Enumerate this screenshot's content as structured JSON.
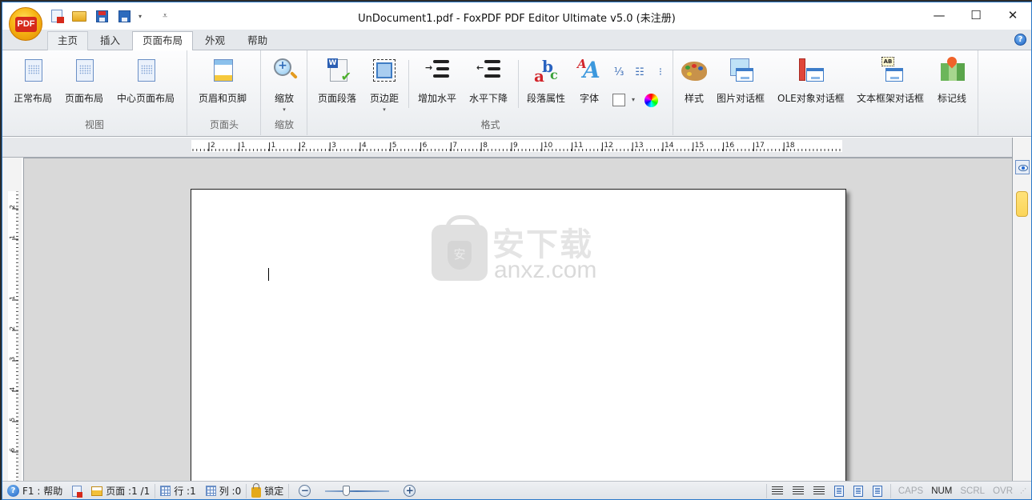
{
  "window": {
    "title": "UnDocument1.pdf - FoxPDF PDF Editor Ultimate v5.0 (未注册)",
    "logo_text": "PDF",
    "controls": {
      "minimize": "—",
      "maximize": "☐",
      "close": "✕"
    }
  },
  "quick_access": [
    {
      "name": "new-pdf",
      "icon": "new-pdf-icon"
    },
    {
      "name": "open",
      "icon": "folder-open-icon"
    },
    {
      "name": "save",
      "icon": "save-icon"
    },
    {
      "name": "save-as",
      "icon": "save-as-icon",
      "dropdown": "▾"
    },
    {
      "name": "customize",
      "glyph": "⩡"
    }
  ],
  "tabs": [
    {
      "label": "主页",
      "active": false
    },
    {
      "label": "插入",
      "active": false
    },
    {
      "label": "页面布局",
      "active": true
    },
    {
      "label": "外观",
      "active": false
    },
    {
      "label": "帮助",
      "active": false
    }
  ],
  "help_glyph": "?",
  "ribbon": {
    "groups": {
      "view": {
        "label": "视图",
        "buttons": [
          "正常布局",
          "页面布局",
          "中心页面布局"
        ]
      },
      "header": {
        "label": "页面头",
        "buttons": [
          "页眉和页脚"
        ]
      },
      "zoom": {
        "label": "缩放",
        "buttons": [
          "缩放"
        ]
      },
      "format": {
        "label": "格式",
        "buttons": [
          "页面段落",
          "页边距",
          "增加水平",
          "水平下降",
          "段落属性",
          "字体"
        ],
        "small_icons": [
          "numbered-list-icon",
          "bullet-list-icon",
          "multilevel-list-icon",
          "border-box-icon",
          "color-wheel-icon"
        ]
      },
      "insert": {
        "buttons": [
          "样式",
          "图片对话框",
          "OLE对象对话框",
          "文本框架对话框",
          "标记线"
        ]
      }
    },
    "dropdown_glyph": "▾"
  },
  "ruler": {
    "horizontal_labels": [
      "2",
      "1",
      "1",
      "2",
      "3",
      "4",
      "5",
      "6",
      "7",
      "8",
      "9",
      "10",
      "11",
      "12",
      "13",
      "14",
      "15",
      "16",
      "17",
      "18"
    ],
    "vertical_labels": [
      "2",
      "1",
      "1",
      "2",
      "3",
      "4",
      "5",
      "6"
    ]
  },
  "document": {
    "watermark_cn": "安下载",
    "watermark_en": "anxz.com",
    "watermark_shield": "安"
  },
  "statusbar": {
    "help": "F1 : 帮助",
    "page": "页面 :1 /1",
    "row": "行 :1",
    "col": "列 :0",
    "lock": "锁定",
    "zoom_out": "−",
    "zoom_in": "+",
    "zoom_level_fraction": 0.3,
    "keys": [
      {
        "label": "CAPS",
        "on": false
      },
      {
        "label": "NUM",
        "on": true
      },
      {
        "label": "SCRL",
        "on": false
      },
      {
        "label": "OVR",
        "on": false
      }
    ]
  }
}
